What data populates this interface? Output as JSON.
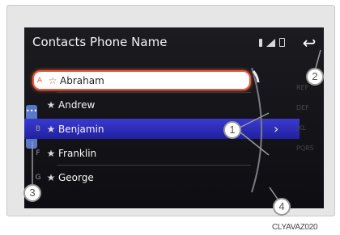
{
  "header": {
    "title": "Contacts Phone Name",
    "status_icons": [
      "bluetooth-icon",
      "signal-icon",
      "battery-icon"
    ],
    "back_icon": "back-arrow-icon"
  },
  "contacts": [
    {
      "index": "A",
      "name": "Abraham",
      "state": "selected"
    },
    {
      "index": "",
      "name": "Andrew",
      "state": "normal"
    },
    {
      "index": "B",
      "name": "Benjamin",
      "state": "highlighted"
    },
    {
      "index": "F",
      "name": "Franklin",
      "state": "normal"
    },
    {
      "index": "G",
      "name": "George",
      "state": "normal"
    }
  ],
  "alpha_index": [
    "REF",
    "DEF",
    "JKL",
    "PQRS"
  ],
  "callouts": [
    "1",
    "2",
    "3",
    "4"
  ],
  "caption": "CLYAVAZ020",
  "colors": {
    "accent": "#e85a3c",
    "highlight": "#2a2ab8",
    "screen_bg": "#141418"
  }
}
